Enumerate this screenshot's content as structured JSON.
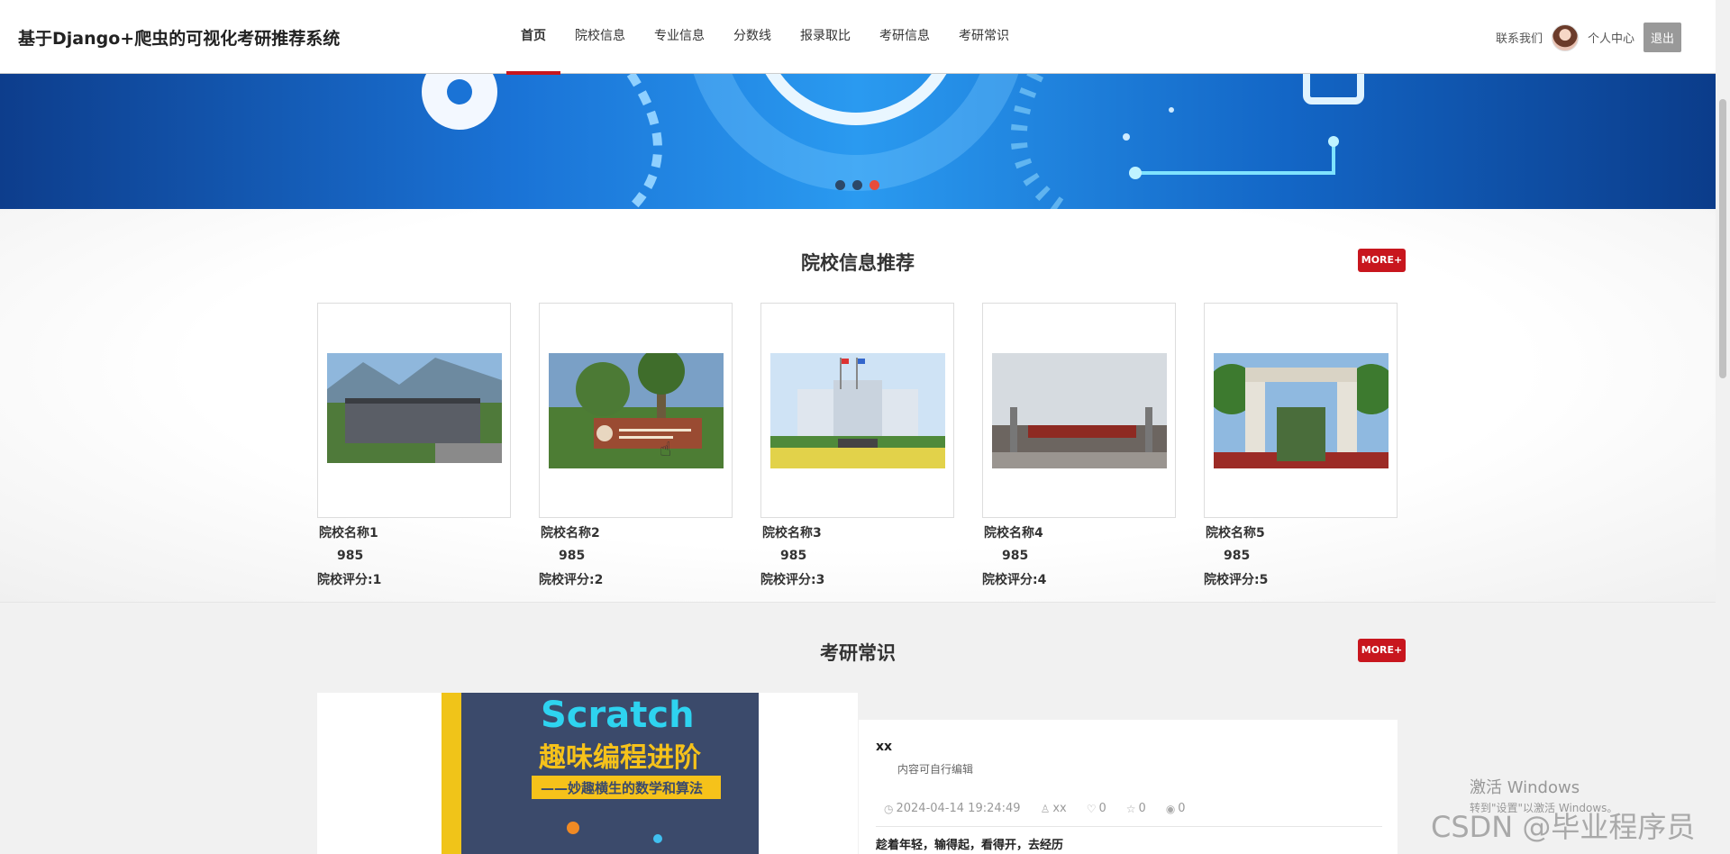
{
  "header": {
    "title": "基于Django+爬虫的可视化考研推荐系统",
    "nav": [
      {
        "label": "首页",
        "active": true
      },
      {
        "label": "院校信息"
      },
      {
        "label": "专业信息"
      },
      {
        "label": "分数线"
      },
      {
        "label": "报录取比"
      },
      {
        "label": "考研信息"
      },
      {
        "label": "考研常识"
      }
    ],
    "contact": "联系我们",
    "profile": "个人中心",
    "logout": "退出"
  },
  "banner": {
    "slide_count": 3,
    "active_slide": 3
  },
  "schools": {
    "title": "院校信息推荐",
    "more": "MORE+",
    "items": [
      {
        "name": "院校名称1",
        "level": "985",
        "score": "院校评分:1"
      },
      {
        "name": "院校名称2",
        "level": "985",
        "score": "院校评分:2"
      },
      {
        "name": "院校名称3",
        "level": "985",
        "score": "院校评分:3"
      },
      {
        "name": "院校名称4",
        "level": "985",
        "score": "院校评分:4"
      },
      {
        "name": "院校名称5",
        "level": "985",
        "score": "院校评分:5"
      }
    ]
  },
  "knowledge": {
    "title": "考研常识",
    "more": "MORE+",
    "book": {
      "line1": "Scratch",
      "line2": "趣味编程进阶",
      "line3": "——妙趣横生的数学和算法"
    },
    "article": {
      "title": "xx",
      "summary": "内容可自行编辑",
      "date": "2024-04-14 19:24:49",
      "author": "xx",
      "likes": "0",
      "favorites": "0",
      "views": "0",
      "footer": "趁着年轻，输得起，看得开，去经历"
    }
  },
  "overlay": {
    "windows_line1": "激活 Windows",
    "windows_line2": "转到\"设置\"以激活 Windows。",
    "watermark": "CSDN @毕业程序员"
  }
}
